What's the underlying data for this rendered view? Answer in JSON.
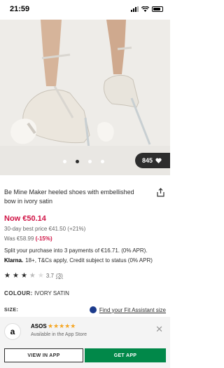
{
  "status_bar": {
    "time": "21:59"
  },
  "gallery": {
    "image_description": "heeled-shoes-photo",
    "slide_count": 5,
    "active_slide": 2,
    "saves": "845"
  },
  "product": {
    "title": "Be Mine Maker heeled shoes with embellished bow in ivory satin",
    "price_now": "Now €50.14",
    "best_price": "30-day best price €41.50 (+21%)",
    "was_price": "Was €58.99",
    "discount": "(-15%)",
    "split_text": "Split your purchase into 3 payments of €16.71. (0% APR).",
    "klarna_brand": "Klarna.",
    "klarna_text": "18+, T&Cs apply, Credit subject to status (0% APR)",
    "rating_value": "3.7",
    "rating_count": "(3)",
    "colour_label": "COLOUR:",
    "colour_value": "IVORY SATIN",
    "size_label": "SIZE:",
    "fit_assistant": "Find your Fit Assistant size"
  },
  "app_banner": {
    "name": "ASOS",
    "stars": "★★★★★",
    "subtitle": "Available in the App Store",
    "view_label": "VIEW IN APP",
    "get_label": "GET APP"
  },
  "colors": {
    "price_red": "#d01345",
    "get_app_green": "#018849",
    "dark": "#2d2d2d"
  }
}
